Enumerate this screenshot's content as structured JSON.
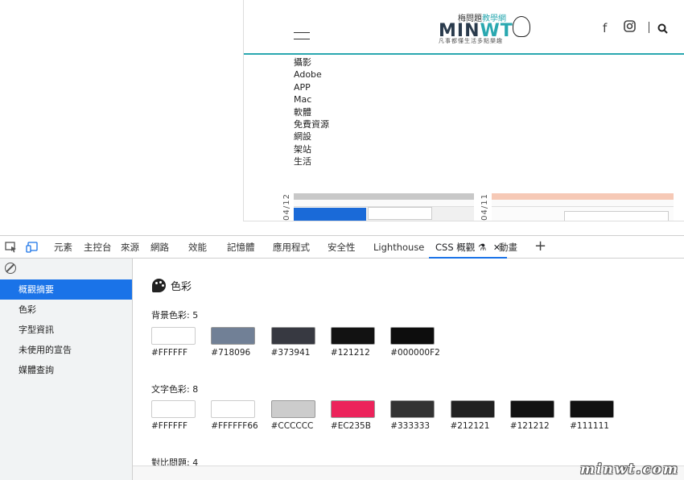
{
  "site": {
    "logo_small": "梅問題",
    "logo_small_accent": "教學網",
    "logo_big": "MIN",
    "logo_big_accent": "WT",
    "logo_tagline": "凡事都懂生活多點樂趣",
    "social_icons": [
      "facebook-icon",
      "instagram-icon",
      "search-icon"
    ],
    "search_symbol": "⚲",
    "nav": [
      "攝影",
      "Adobe",
      "APP",
      "Mac",
      "軟體",
      "免費資源",
      "網設",
      "架站",
      "生活"
    ],
    "dates": [
      "/04/12",
      "/04/11"
    ],
    "accent_color": "#2aa8b0"
  },
  "devtools": {
    "tabs": [
      "元素",
      "主控台",
      "來源",
      "網路",
      "效能",
      "記憶體",
      "應用程式",
      "安全性",
      "Lighthouse",
      "CSS 概觀",
      "動畫"
    ],
    "active_tab_index": 9,
    "close_symbol": "✕",
    "flask_symbol": "⚗",
    "plus_symbol": "+",
    "sidebar": [
      "概觀摘要",
      "色彩",
      "字型資訊",
      "未使用的宣告",
      "媒體查詢"
    ],
    "active_sidebar_index": 0,
    "accent_color": "#1a73e8"
  },
  "overview": {
    "section_title": "色彩",
    "background_label": "背景色彩: 5",
    "background_colors": [
      "#FFFFFF",
      "#718096",
      "#373941",
      "#121212",
      "#000000F2"
    ],
    "text_label": "文字色彩: 8",
    "text_colors": [
      "#FFFFFF",
      "#FFFFFF66",
      "#CCCCCC",
      "#EC235B",
      "#333333",
      "#212121",
      "#121212",
      "#111111"
    ],
    "contrast_label": "對比問題: 4"
  },
  "watermark": "minwt.com"
}
